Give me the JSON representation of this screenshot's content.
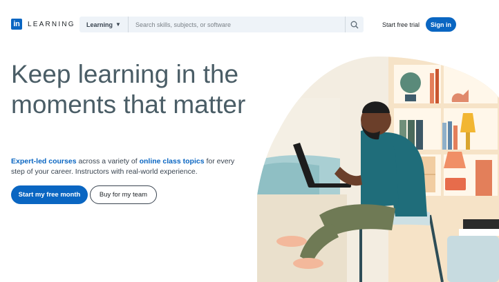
{
  "header": {
    "logo_mark": "in",
    "logo_text": "LEARNING",
    "category_label": "Learning",
    "search_placeholder": "Search skills, subjects, or software",
    "trial_label": "Start free trial",
    "signin_label": "Sign in"
  },
  "hero": {
    "title": "Keep learning in the moments that matter",
    "desc_link1": "Expert-led courses",
    "desc_text1": " across a variety of ",
    "desc_link2": "online class topics",
    "desc_text2": " for every step of your career. Instructors with real-world experience.",
    "primary_button": "Start my free month",
    "secondary_button": "Buy for my team"
  },
  "colors": {
    "brand": "#0a66c2",
    "title": "#4a5d66",
    "search_bg": "#eef3f8"
  },
  "icons": {
    "search": "search-icon",
    "caret": "chevron-down-icon"
  }
}
